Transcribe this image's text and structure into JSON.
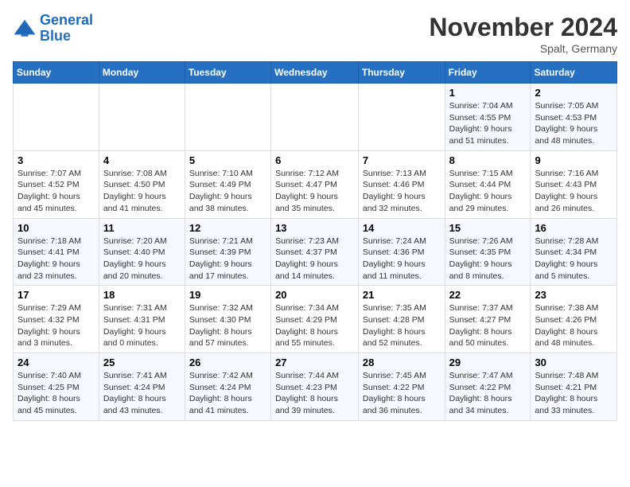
{
  "logo": {
    "line1": "General",
    "line2": "Blue"
  },
  "title": "November 2024",
  "location": "Spalt, Germany",
  "days_of_week": [
    "Sunday",
    "Monday",
    "Tuesday",
    "Wednesday",
    "Thursday",
    "Friday",
    "Saturday"
  ],
  "weeks": [
    [
      {
        "day": "",
        "details": ""
      },
      {
        "day": "",
        "details": ""
      },
      {
        "day": "",
        "details": ""
      },
      {
        "day": "",
        "details": ""
      },
      {
        "day": "",
        "details": ""
      },
      {
        "day": "1",
        "details": "Sunrise: 7:04 AM\nSunset: 4:55 PM\nDaylight: 9 hours\nand 51 minutes."
      },
      {
        "day": "2",
        "details": "Sunrise: 7:05 AM\nSunset: 4:53 PM\nDaylight: 9 hours\nand 48 minutes."
      }
    ],
    [
      {
        "day": "3",
        "details": "Sunrise: 7:07 AM\nSunset: 4:52 PM\nDaylight: 9 hours\nand 45 minutes."
      },
      {
        "day": "4",
        "details": "Sunrise: 7:08 AM\nSunset: 4:50 PM\nDaylight: 9 hours\nand 41 minutes."
      },
      {
        "day": "5",
        "details": "Sunrise: 7:10 AM\nSunset: 4:49 PM\nDaylight: 9 hours\nand 38 minutes."
      },
      {
        "day": "6",
        "details": "Sunrise: 7:12 AM\nSunset: 4:47 PM\nDaylight: 9 hours\nand 35 minutes."
      },
      {
        "day": "7",
        "details": "Sunrise: 7:13 AM\nSunset: 4:46 PM\nDaylight: 9 hours\nand 32 minutes."
      },
      {
        "day": "8",
        "details": "Sunrise: 7:15 AM\nSunset: 4:44 PM\nDaylight: 9 hours\nand 29 minutes."
      },
      {
        "day": "9",
        "details": "Sunrise: 7:16 AM\nSunset: 4:43 PM\nDaylight: 9 hours\nand 26 minutes."
      }
    ],
    [
      {
        "day": "10",
        "details": "Sunrise: 7:18 AM\nSunset: 4:41 PM\nDaylight: 9 hours\nand 23 minutes."
      },
      {
        "day": "11",
        "details": "Sunrise: 7:20 AM\nSunset: 4:40 PM\nDaylight: 9 hours\nand 20 minutes."
      },
      {
        "day": "12",
        "details": "Sunrise: 7:21 AM\nSunset: 4:39 PM\nDaylight: 9 hours\nand 17 minutes."
      },
      {
        "day": "13",
        "details": "Sunrise: 7:23 AM\nSunset: 4:37 PM\nDaylight: 9 hours\nand 14 minutes."
      },
      {
        "day": "14",
        "details": "Sunrise: 7:24 AM\nSunset: 4:36 PM\nDaylight: 9 hours\nand 11 minutes."
      },
      {
        "day": "15",
        "details": "Sunrise: 7:26 AM\nSunset: 4:35 PM\nDaylight: 9 hours\nand 8 minutes."
      },
      {
        "day": "16",
        "details": "Sunrise: 7:28 AM\nSunset: 4:34 PM\nDaylight: 9 hours\nand 5 minutes."
      }
    ],
    [
      {
        "day": "17",
        "details": "Sunrise: 7:29 AM\nSunset: 4:32 PM\nDaylight: 9 hours\nand 3 minutes."
      },
      {
        "day": "18",
        "details": "Sunrise: 7:31 AM\nSunset: 4:31 PM\nDaylight: 9 hours\nand 0 minutes."
      },
      {
        "day": "19",
        "details": "Sunrise: 7:32 AM\nSunset: 4:30 PM\nDaylight: 8 hours\nand 57 minutes."
      },
      {
        "day": "20",
        "details": "Sunrise: 7:34 AM\nSunset: 4:29 PM\nDaylight: 8 hours\nand 55 minutes."
      },
      {
        "day": "21",
        "details": "Sunrise: 7:35 AM\nSunset: 4:28 PM\nDaylight: 8 hours\nand 52 minutes."
      },
      {
        "day": "22",
        "details": "Sunrise: 7:37 AM\nSunset: 4:27 PM\nDaylight: 8 hours\nand 50 minutes."
      },
      {
        "day": "23",
        "details": "Sunrise: 7:38 AM\nSunset: 4:26 PM\nDaylight: 8 hours\nand 48 minutes."
      }
    ],
    [
      {
        "day": "24",
        "details": "Sunrise: 7:40 AM\nSunset: 4:25 PM\nDaylight: 8 hours\nand 45 minutes."
      },
      {
        "day": "25",
        "details": "Sunrise: 7:41 AM\nSunset: 4:24 PM\nDaylight: 8 hours\nand 43 minutes."
      },
      {
        "day": "26",
        "details": "Sunrise: 7:42 AM\nSunset: 4:24 PM\nDaylight: 8 hours\nand 41 minutes."
      },
      {
        "day": "27",
        "details": "Sunrise: 7:44 AM\nSunset: 4:23 PM\nDaylight: 8 hours\nand 39 minutes."
      },
      {
        "day": "28",
        "details": "Sunrise: 7:45 AM\nSunset: 4:22 PM\nDaylight: 8 hours\nand 36 minutes."
      },
      {
        "day": "29",
        "details": "Sunrise: 7:47 AM\nSunset: 4:22 PM\nDaylight: 8 hours\nand 34 minutes."
      },
      {
        "day": "30",
        "details": "Sunrise: 7:48 AM\nSunset: 4:21 PM\nDaylight: 8 hours\nand 33 minutes."
      }
    ]
  ]
}
